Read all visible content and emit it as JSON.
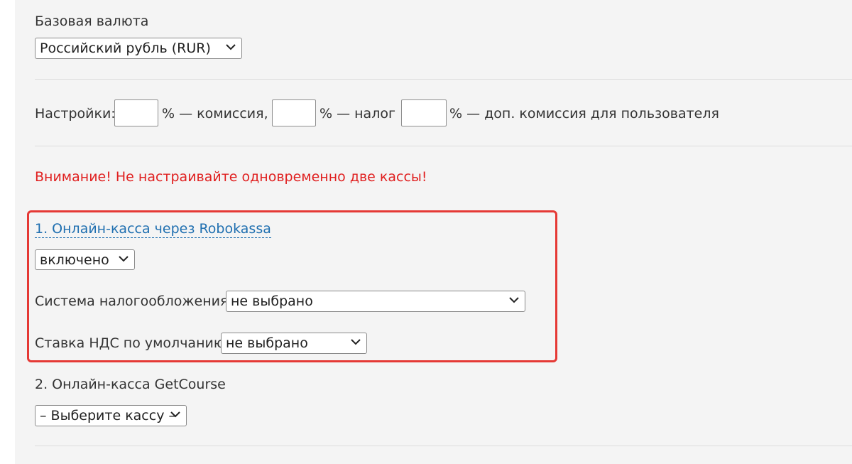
{
  "base_currency": {
    "label": "Базовая валюта",
    "selected": "Российский рубль (RUR)"
  },
  "settings": {
    "label": "Настройки:",
    "commission_suffix": "% — комиссия,",
    "commission_value": "",
    "tax_suffix": "% — налог",
    "tax_value": "",
    "extra_commission_suffix": "% — доп. комиссия для пользователя",
    "extra_commission_value": ""
  },
  "warning": "Внимание! Не настраивайте одновременно две кассы!",
  "robokassa": {
    "title": "1. Онлайн-касса через Robokassa",
    "state_selected": "включено",
    "tax_system_label": "Система налогообложения:",
    "tax_system_selected": "не выбрано",
    "vat_label": "Ставка НДС по умолчанию:",
    "vat_selected": "не выбрано"
  },
  "getcourse": {
    "title": "2. Онлайн-касса GetCourse",
    "selected": "– Выберите кассу –"
  },
  "colors": {
    "background": "#f4f4f4",
    "warning": "#e02020",
    "link": "#1f6fb0",
    "highlight": "#e53935"
  }
}
